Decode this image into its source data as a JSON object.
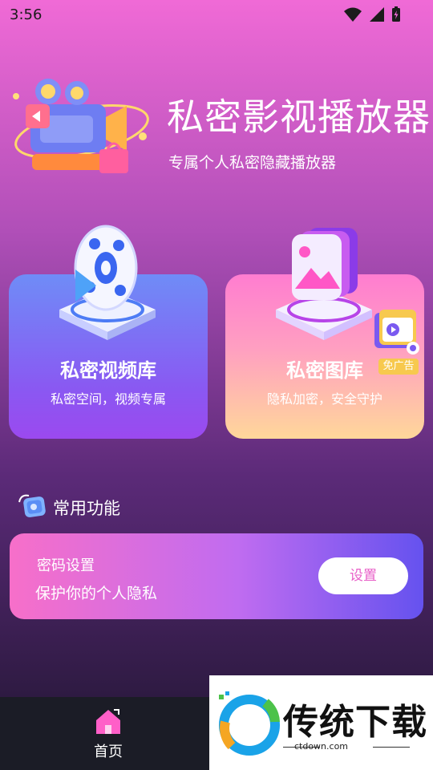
{
  "status_bar": {
    "time": "3:56",
    "icons": [
      "wifi-icon",
      "cellular-signal-icon",
      "battery-charging-icon"
    ]
  },
  "header": {
    "title": "私密影视播放器",
    "subtitle": "专属个人私密隐藏播放器"
  },
  "cards": [
    {
      "title": "私密视频库",
      "desc": "私密空间，视频专属",
      "icon": "film-reel-icon"
    },
    {
      "title": "私密图库",
      "desc": "隐私加密，安全守护",
      "icon": "photo-gallery-icon",
      "badge": "免广告"
    }
  ],
  "common": {
    "section_title": "常用功能",
    "feature": {
      "title": "密码设置",
      "desc": "保护你的个人隐私",
      "button": "设置"
    }
  },
  "bottom_nav": {
    "home_label": "首页"
  },
  "watermark": {
    "text": "传统下载",
    "url": "ctdown.com"
  },
  "colors": {
    "accent_pink": "#e85fc8",
    "nav_bg": "#1b1c26",
    "home_icon": "#ff5fc8"
  }
}
